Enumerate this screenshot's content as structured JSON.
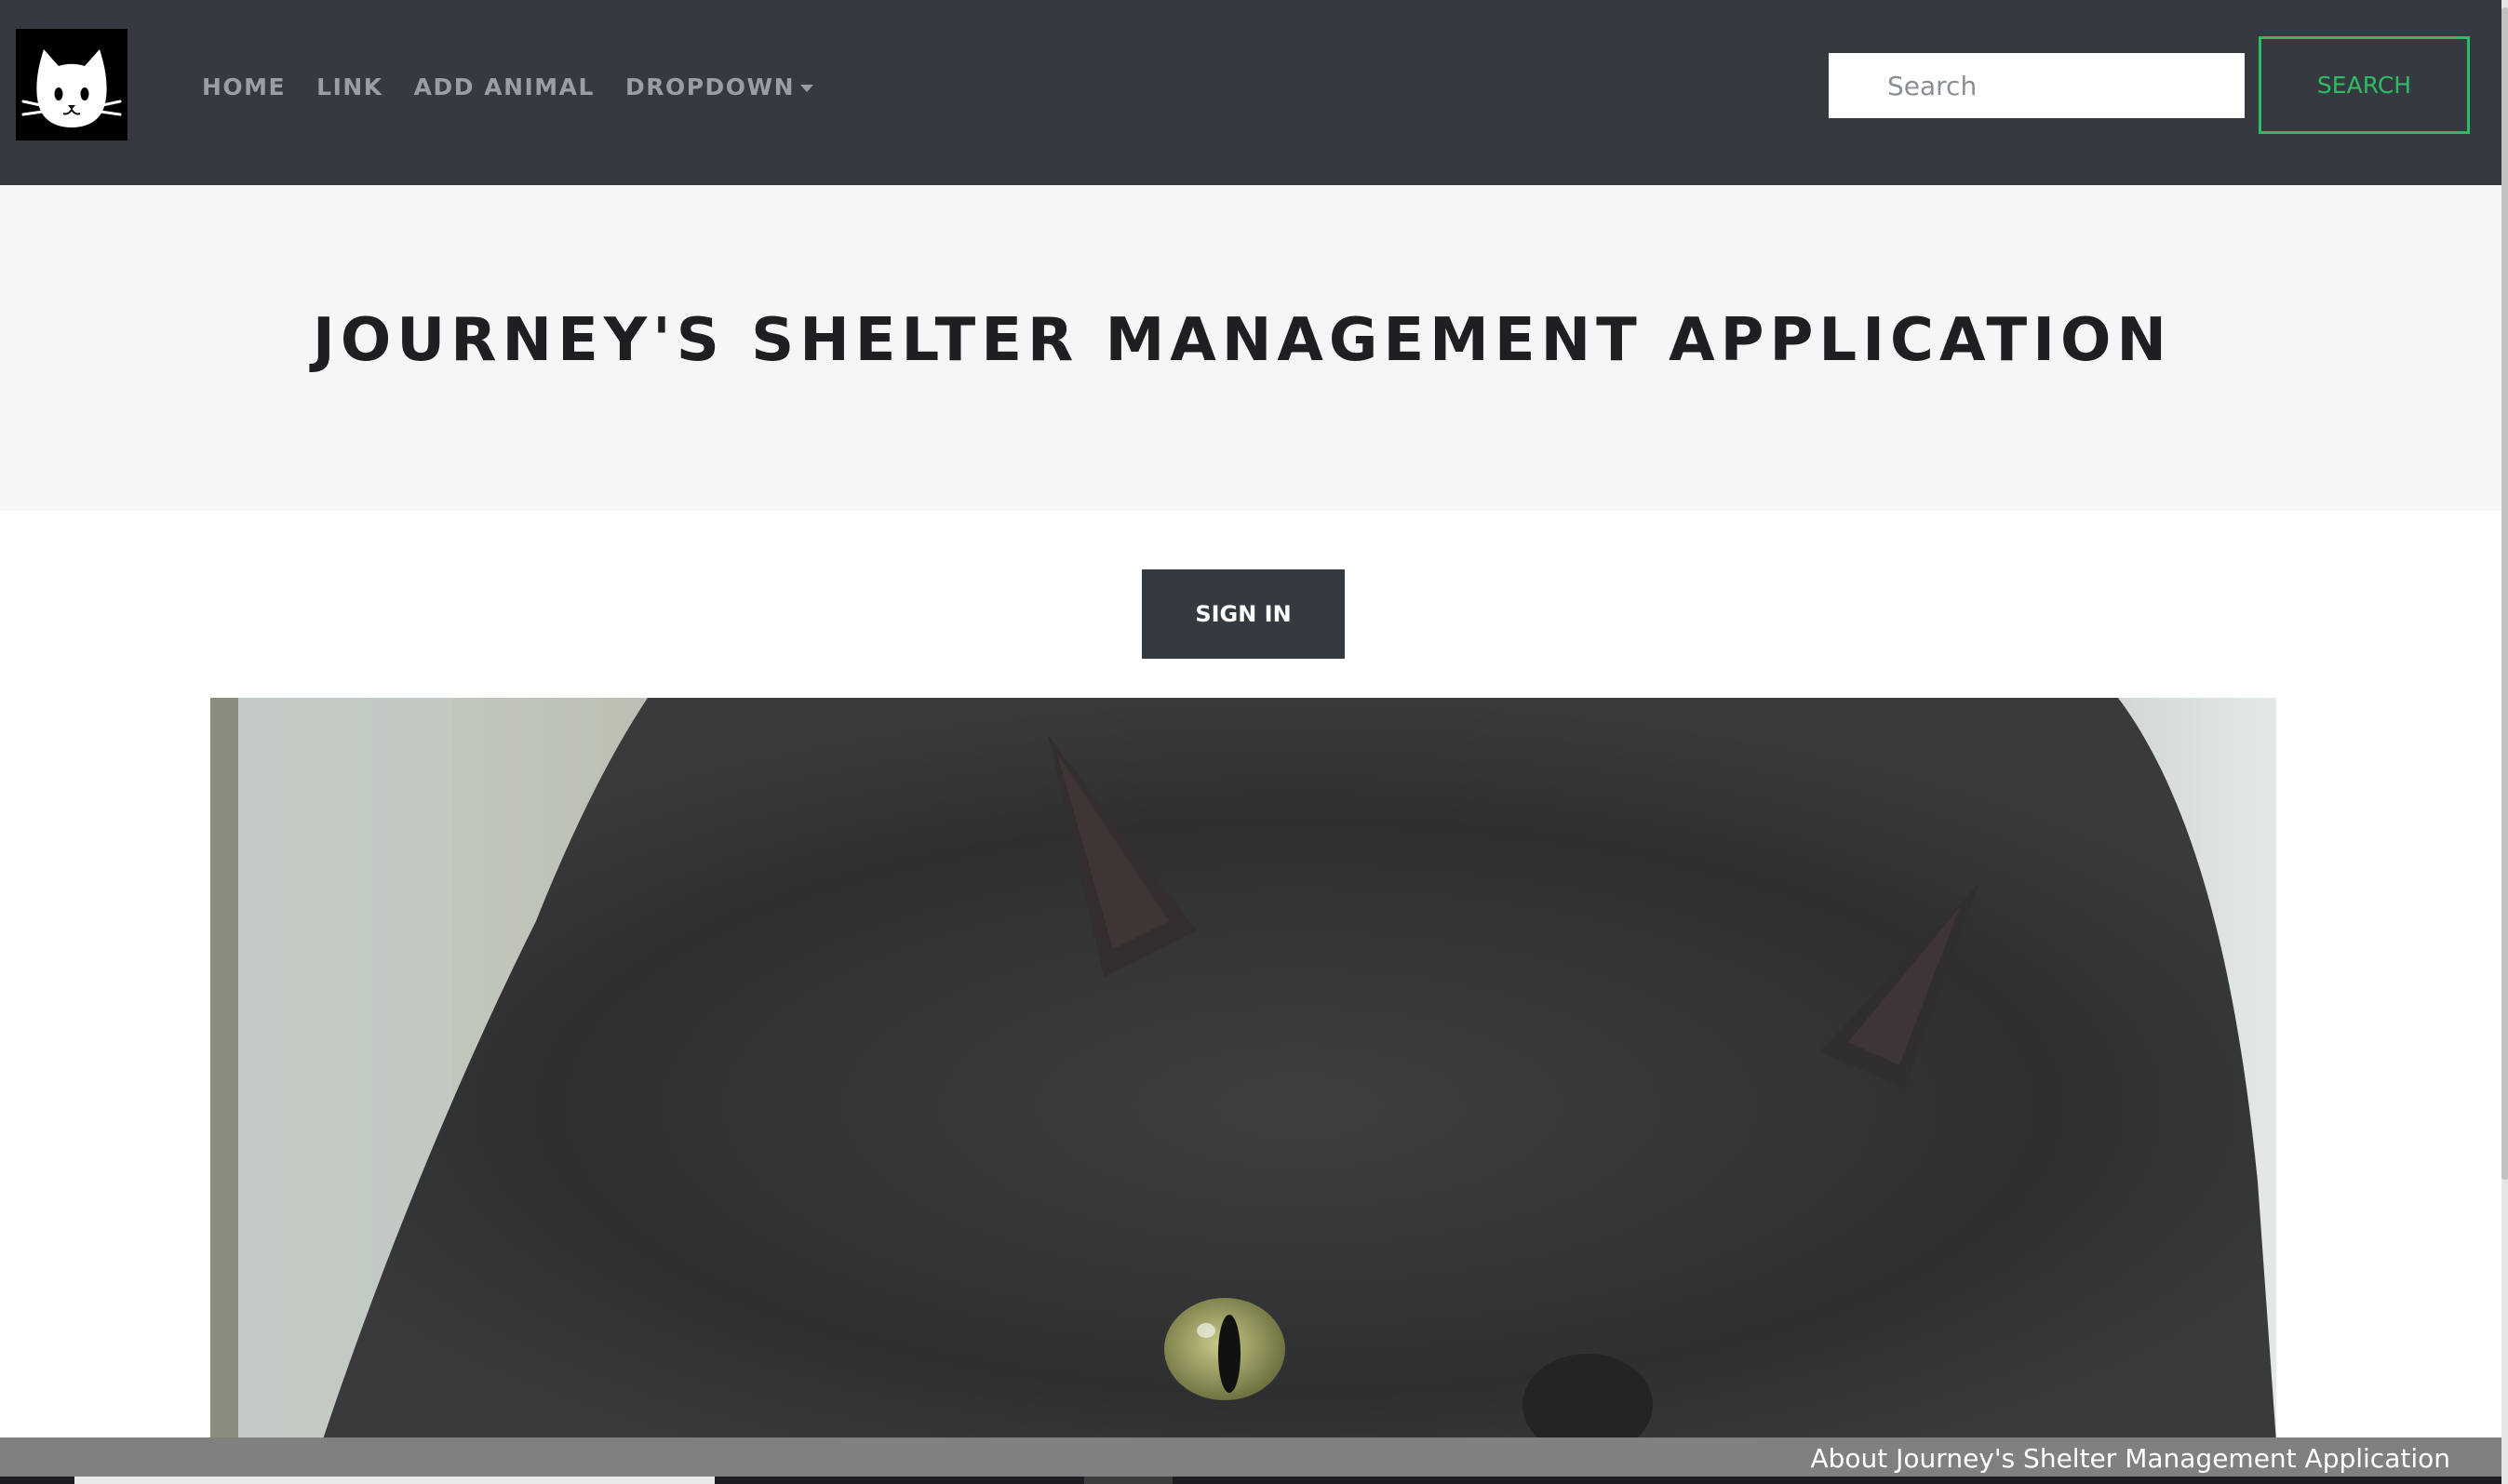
{
  "brand": {
    "icon": "cat-logo-icon"
  },
  "nav": {
    "items": [
      {
        "label": "HOME"
      },
      {
        "label": "LINK"
      },
      {
        "label": "ADD ANIMAL"
      },
      {
        "label": "DROPDOWN"
      }
    ]
  },
  "search": {
    "placeholder": "Search",
    "value": "",
    "button_label": "SEARCH"
  },
  "jumbotron": {
    "title": "JOURNEY'S SHELTER MANAGEMENT APPLICATION"
  },
  "auth": {
    "signin_label": "SIGN IN"
  },
  "footer": {
    "text": "About Journey's Shelter Management Application"
  },
  "colors": {
    "navbar": "#343a40",
    "search_accent": "#2ebd63",
    "jumbotron_bg": "#f6f6f8",
    "footer_bg": "#808080"
  }
}
